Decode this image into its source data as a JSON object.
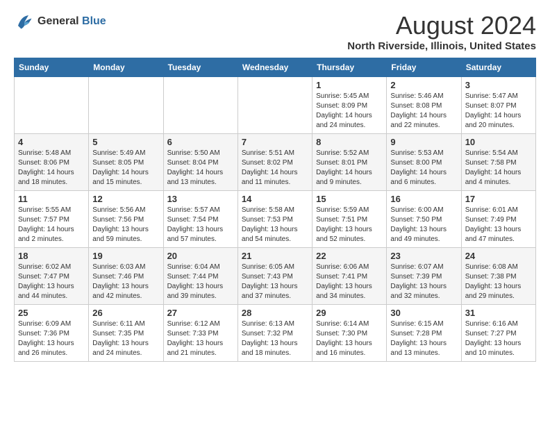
{
  "header": {
    "logo_line1": "General",
    "logo_line2": "Blue",
    "month_title": "August 2024",
    "subtitle": "North Riverside, Illinois, United States"
  },
  "days_of_week": [
    "Sunday",
    "Monday",
    "Tuesday",
    "Wednesday",
    "Thursday",
    "Friday",
    "Saturday"
  ],
  "weeks": [
    [
      {
        "day": "",
        "info": ""
      },
      {
        "day": "",
        "info": ""
      },
      {
        "day": "",
        "info": ""
      },
      {
        "day": "",
        "info": ""
      },
      {
        "day": "1",
        "info": "Sunrise: 5:45 AM\nSunset: 8:09 PM\nDaylight: 14 hours\nand 24 minutes."
      },
      {
        "day": "2",
        "info": "Sunrise: 5:46 AM\nSunset: 8:08 PM\nDaylight: 14 hours\nand 22 minutes."
      },
      {
        "day": "3",
        "info": "Sunrise: 5:47 AM\nSunset: 8:07 PM\nDaylight: 14 hours\nand 20 minutes."
      }
    ],
    [
      {
        "day": "4",
        "info": "Sunrise: 5:48 AM\nSunset: 8:06 PM\nDaylight: 14 hours\nand 18 minutes."
      },
      {
        "day": "5",
        "info": "Sunrise: 5:49 AM\nSunset: 8:05 PM\nDaylight: 14 hours\nand 15 minutes."
      },
      {
        "day": "6",
        "info": "Sunrise: 5:50 AM\nSunset: 8:04 PM\nDaylight: 14 hours\nand 13 minutes."
      },
      {
        "day": "7",
        "info": "Sunrise: 5:51 AM\nSunset: 8:02 PM\nDaylight: 14 hours\nand 11 minutes."
      },
      {
        "day": "8",
        "info": "Sunrise: 5:52 AM\nSunset: 8:01 PM\nDaylight: 14 hours\nand 9 minutes."
      },
      {
        "day": "9",
        "info": "Sunrise: 5:53 AM\nSunset: 8:00 PM\nDaylight: 14 hours\nand 6 minutes."
      },
      {
        "day": "10",
        "info": "Sunrise: 5:54 AM\nSunset: 7:58 PM\nDaylight: 14 hours\nand 4 minutes."
      }
    ],
    [
      {
        "day": "11",
        "info": "Sunrise: 5:55 AM\nSunset: 7:57 PM\nDaylight: 14 hours\nand 2 minutes."
      },
      {
        "day": "12",
        "info": "Sunrise: 5:56 AM\nSunset: 7:56 PM\nDaylight: 13 hours\nand 59 minutes."
      },
      {
        "day": "13",
        "info": "Sunrise: 5:57 AM\nSunset: 7:54 PM\nDaylight: 13 hours\nand 57 minutes."
      },
      {
        "day": "14",
        "info": "Sunrise: 5:58 AM\nSunset: 7:53 PM\nDaylight: 13 hours\nand 54 minutes."
      },
      {
        "day": "15",
        "info": "Sunrise: 5:59 AM\nSunset: 7:51 PM\nDaylight: 13 hours\nand 52 minutes."
      },
      {
        "day": "16",
        "info": "Sunrise: 6:00 AM\nSunset: 7:50 PM\nDaylight: 13 hours\nand 49 minutes."
      },
      {
        "day": "17",
        "info": "Sunrise: 6:01 AM\nSunset: 7:49 PM\nDaylight: 13 hours\nand 47 minutes."
      }
    ],
    [
      {
        "day": "18",
        "info": "Sunrise: 6:02 AM\nSunset: 7:47 PM\nDaylight: 13 hours\nand 44 minutes."
      },
      {
        "day": "19",
        "info": "Sunrise: 6:03 AM\nSunset: 7:46 PM\nDaylight: 13 hours\nand 42 minutes."
      },
      {
        "day": "20",
        "info": "Sunrise: 6:04 AM\nSunset: 7:44 PM\nDaylight: 13 hours\nand 39 minutes."
      },
      {
        "day": "21",
        "info": "Sunrise: 6:05 AM\nSunset: 7:43 PM\nDaylight: 13 hours\nand 37 minutes."
      },
      {
        "day": "22",
        "info": "Sunrise: 6:06 AM\nSunset: 7:41 PM\nDaylight: 13 hours\nand 34 minutes."
      },
      {
        "day": "23",
        "info": "Sunrise: 6:07 AM\nSunset: 7:39 PM\nDaylight: 13 hours\nand 32 minutes."
      },
      {
        "day": "24",
        "info": "Sunrise: 6:08 AM\nSunset: 7:38 PM\nDaylight: 13 hours\nand 29 minutes."
      }
    ],
    [
      {
        "day": "25",
        "info": "Sunrise: 6:09 AM\nSunset: 7:36 PM\nDaylight: 13 hours\nand 26 minutes."
      },
      {
        "day": "26",
        "info": "Sunrise: 6:11 AM\nSunset: 7:35 PM\nDaylight: 13 hours\nand 24 minutes."
      },
      {
        "day": "27",
        "info": "Sunrise: 6:12 AM\nSunset: 7:33 PM\nDaylight: 13 hours\nand 21 minutes."
      },
      {
        "day": "28",
        "info": "Sunrise: 6:13 AM\nSunset: 7:32 PM\nDaylight: 13 hours\nand 18 minutes."
      },
      {
        "day": "29",
        "info": "Sunrise: 6:14 AM\nSunset: 7:30 PM\nDaylight: 13 hours\nand 16 minutes."
      },
      {
        "day": "30",
        "info": "Sunrise: 6:15 AM\nSunset: 7:28 PM\nDaylight: 13 hours\nand 13 minutes."
      },
      {
        "day": "31",
        "info": "Sunrise: 6:16 AM\nSunset: 7:27 PM\nDaylight: 13 hours\nand 10 minutes."
      }
    ]
  ]
}
